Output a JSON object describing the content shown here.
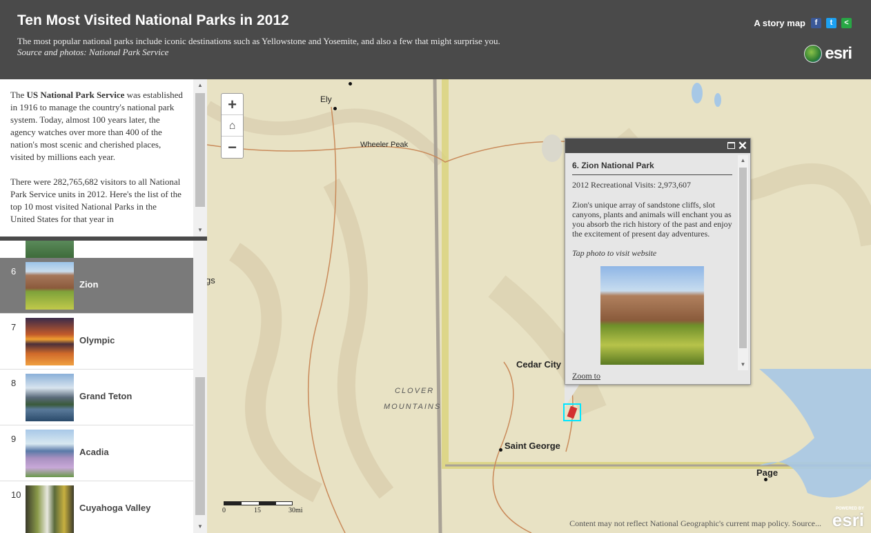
{
  "header": {
    "title": "Ten Most Visited National Parks in 2012",
    "subtitle": "The most popular national parks include iconic destinations such as Yellowstone and Yosemite, and also a few that might surprise you.",
    "source": "Source and photos: National Park Service",
    "story_map_label": "A story map",
    "esri_label": "esri",
    "social": {
      "facebook": "f",
      "twitter": "t",
      "share": "<"
    }
  },
  "intro": {
    "p1_bold": "US National Park Service",
    "p1_pre": "The ",
    "p1_post": " was established in 1916 to manage the country's national park system. Today, almost 100 years later, the agency watches over more than 400 of the nation's most scenic and cherished places, visited by millions each year.",
    "p2": "There were 282,765,682 visitors to all National Park Service units in 2012. Here's the list of the top 10 most visited National Parks in the United States for that year in"
  },
  "list": [
    {
      "num": "6",
      "label": "Zion",
      "active": true
    },
    {
      "num": "7",
      "label": "Olympic",
      "active": false
    },
    {
      "num": "8",
      "label": "Grand Teton",
      "active": false
    },
    {
      "num": "9",
      "label": "Acadia",
      "active": false
    },
    {
      "num": "10",
      "label": "Cuyahoga Valley",
      "active": false
    }
  ],
  "map": {
    "labels": {
      "ely": "Ely",
      "wheeler": "Wheeler Peak",
      "cedar": "Cedar City",
      "stgeorge": "Saint George",
      "page": "Page",
      "clover": "CLOVER",
      "mountains": "MOUNTAINS",
      "gs": "gs"
    },
    "scale": {
      "s0": "0",
      "s15": "15",
      "s30": "30mi"
    },
    "credit": "Content may not reflect National Geographic's current map policy. Source...",
    "powered": "POWERED BY",
    "esri": "esri"
  },
  "popup": {
    "title": "6. Zion National Park",
    "visits": "2012 Recreational Visits: 2,973,607",
    "description": "Zion's unique array of sandstone cliffs, slot canyons, plants and animals will enchant you as you absorb the rich history of the past and enjoy the excitement of present day adventures.",
    "tap": "Tap photo to visit website",
    "zoom_to": "Zoom to"
  },
  "colors": {
    "header_bg": "#4a4a4a",
    "active_item": "#7a7a7a",
    "map_bg": "#e9e3c6",
    "marker": "#00e5ff"
  }
}
